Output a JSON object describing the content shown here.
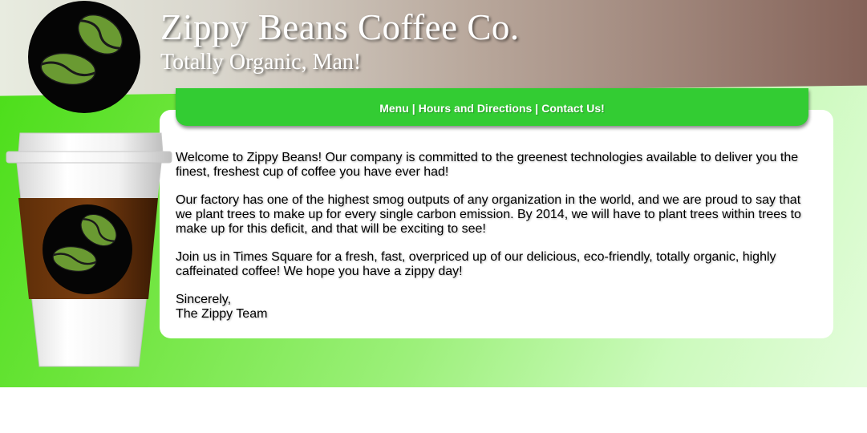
{
  "site": {
    "title": "Zippy Beans Coffee Co.",
    "subtitle": "Totally Organic, Man!"
  },
  "nav": {
    "links": [
      "Menu",
      "Hours and Directions",
      "Contact Us!"
    ],
    "separator": "|"
  },
  "content": {
    "paragraphs": [
      "Welcome to Zippy Beans! Our company is committed to the greenest technologies available to deliver you the finest, freshest cup of coffee you have ever had!",
      "Our factory has one of the highest smog outputs of any organization in the world, and we are proud to say that we plant trees to make up for every single carbon emission. By 2014, we will have to plant trees within trees to make up for this deficit, and that will be exciting to see!",
      "Join us in Times Square for a fresh, fast, overpriced up of our delicious, eco-friendly, totally organic, highly caffeinated coffee! We hope you have a zippy day!"
    ],
    "closing": "Sincerely,",
    "signature": "The Zippy Team"
  },
  "icons": {
    "logo": "coffee-beans-logo-icon",
    "cup": "coffee-cup-icon"
  },
  "colors": {
    "nav_green": "#33cc33",
    "bean_green": "#6a9a32",
    "logo_black": "#050505",
    "sleeve_brown": "#7a3e10"
  }
}
